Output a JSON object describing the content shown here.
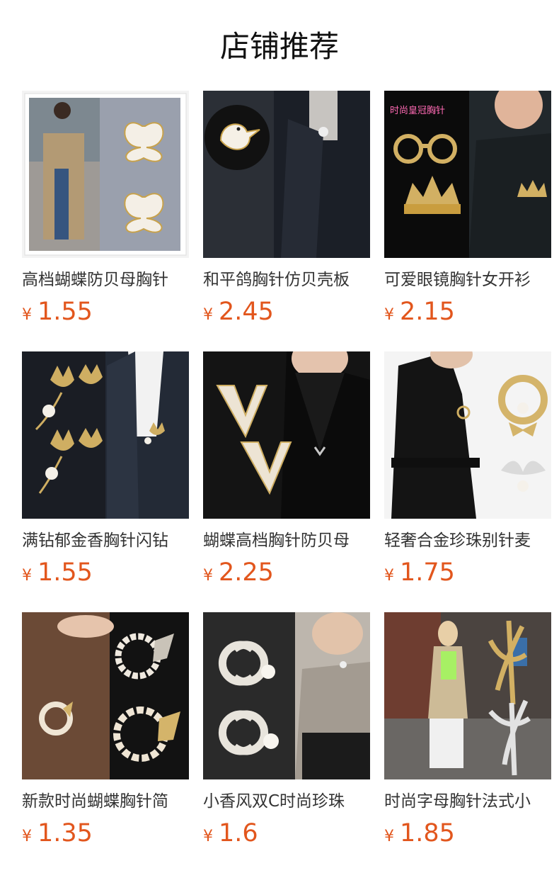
{
  "section": {
    "title": "店铺推荐"
  },
  "currency_symbol": "¥",
  "products": [
    {
      "name": "高档蝴蝶防贝母胸针",
      "price": "1.55",
      "icon": "butterfly-brooch-image"
    },
    {
      "name": "和平鸽胸针仿贝壳板",
      "price": "2.45",
      "icon": "dove-brooch-image"
    },
    {
      "name": "可爱眼镜胸针女开衫",
      "price": "2.15",
      "icon": "glasses-crown-brooch-image"
    },
    {
      "name": "满钻郁金香胸针闪钻",
      "price": "1.55",
      "icon": "tulip-brooch-image"
    },
    {
      "name": "蝴蝶高档胸针防贝母",
      "price": "2.25",
      "icon": "v-letter-brooch-image"
    },
    {
      "name": "轻奢合金珍珠别针麦",
      "price": "1.75",
      "icon": "wreath-pearl-brooch-image"
    },
    {
      "name": "新款时尚蝴蝶胸针简",
      "price": "1.35",
      "icon": "pearl-wreath-butterfly-brooch-image"
    },
    {
      "name": "小香风双C时尚珍珠",
      "price": "1.6",
      "icon": "double-c-brooch-image"
    },
    {
      "name": "时尚字母胸针法式小",
      "price": "1.85",
      "icon": "letter-brooch-image"
    }
  ],
  "thumbnail_overlay_text": "时尚皇冠胸针"
}
